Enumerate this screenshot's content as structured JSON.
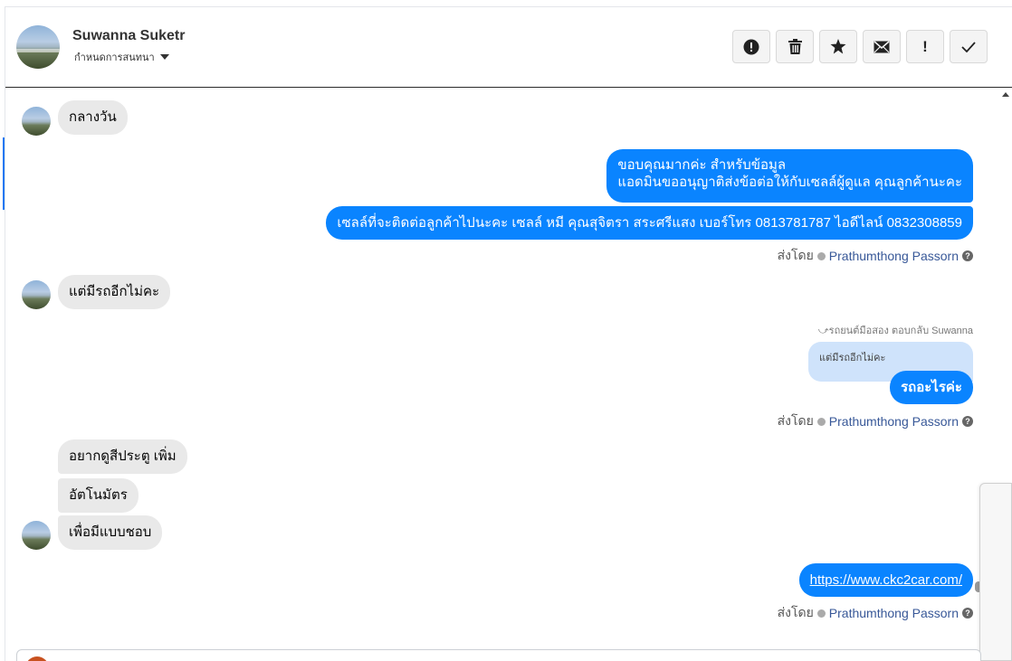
{
  "header": {
    "contact_name": "Suwanna Suketr",
    "subtitle": "กำหนดการสนทนา",
    "actions": [
      {
        "icon": "alert-circle-icon"
      },
      {
        "icon": "trash-icon"
      },
      {
        "icon": "star-icon"
      },
      {
        "icon": "envelope-icon"
      },
      {
        "icon": "exclamation-icon",
        "label": "!"
      },
      {
        "icon": "check-icon"
      }
    ]
  },
  "messages": {
    "m1": "กลางวัน",
    "m2_line1": "ขอบคุณมากค่ะ สำหรับข้อมูล",
    "m2_line2": "แอดมินขออนุญาติส่งข้อต่อให้กับเซลล์ผู้ดูแล คุณลูกค้านะคะ",
    "m3": "เซลล์ที่จะติดต่อลูกค้าไปนะคะ เซลล์ หมี คุณสุจิตรา สระศรีแสง เบอร์โทร 0813781787 ไอดีไลน์ 0832308859",
    "m4": "แต่มีรถอีกไม่คะ",
    "reply_label": "รถยนต์มือสอง ตอบกลับ Suwanna",
    "quote": "แต่มีรถอีกไม่คะ",
    "m5": "รถอะไรค่ะ",
    "m6": "อยากดูสีประตู เพิ่ม",
    "m7": "อัตโนมัตร",
    "m8": "เพื่อมีแบบชอบ",
    "m9": "https://www.ckc2car.com/"
  },
  "sent_by": {
    "prefix": "ส่งโดย",
    "agent": "Prathumthong Passorn",
    "help": "?"
  },
  "colors": {
    "outgoing_bubble": "#0a84ff",
    "incoming_bubble": "#e9e9e9",
    "quote_bubble": "#cfe3fb",
    "agent_link": "#385898"
  }
}
